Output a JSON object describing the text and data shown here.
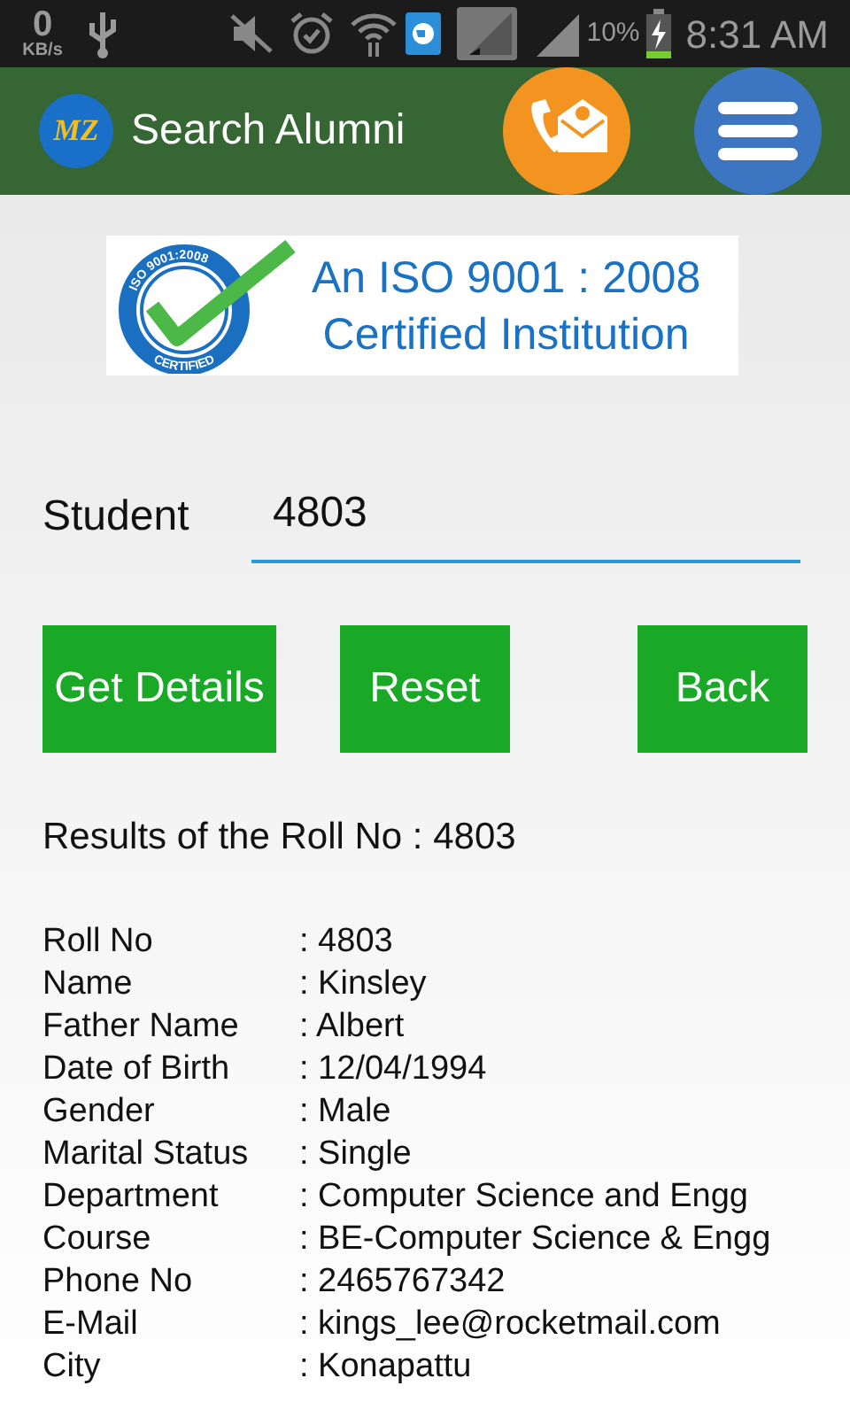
{
  "status_bar": {
    "speed": "0",
    "speed_unit": "KB/s",
    "battery": "10%",
    "time": "8:31 AM"
  },
  "header": {
    "logo": "MZ",
    "title": "Search Alumni"
  },
  "banner": {
    "seal_top": "ISO 9001:2008",
    "seal_bottom": "CERTIFIED",
    "line_1": "An ISO 9001 : 2008",
    "line_2": "Certified Institution"
  },
  "form": {
    "label": "Student",
    "value": "4803"
  },
  "buttons": [
    "Get Details",
    "Reset",
    "Back"
  ],
  "results_title": "Results of the Roll No : 4803",
  "details": [
    {
      "label": "Roll No",
      "value": ": 4803"
    },
    {
      "label": "Name",
      "value": ": Kinsley"
    },
    {
      "label": "Father Name",
      "value": ": Albert"
    },
    {
      "label": "Date of Birth",
      "value": ": 12/04/1994"
    },
    {
      "label": "Gender",
      "value": ": Male"
    },
    {
      "label": "Marital Status",
      "value": ": Single"
    },
    {
      "label": "Department",
      "value": ": Computer Science and Engg"
    },
    {
      "label": "Course",
      "value": ": BE-Computer Science & Engg"
    },
    {
      "label": "Phone No",
      "value": ": 2465767342"
    },
    {
      "label": "E-Mail",
      "value": ": kings_lee@rocketmail.com"
    },
    {
      "label": "City",
      "value": ": Konapattu"
    }
  ]
}
